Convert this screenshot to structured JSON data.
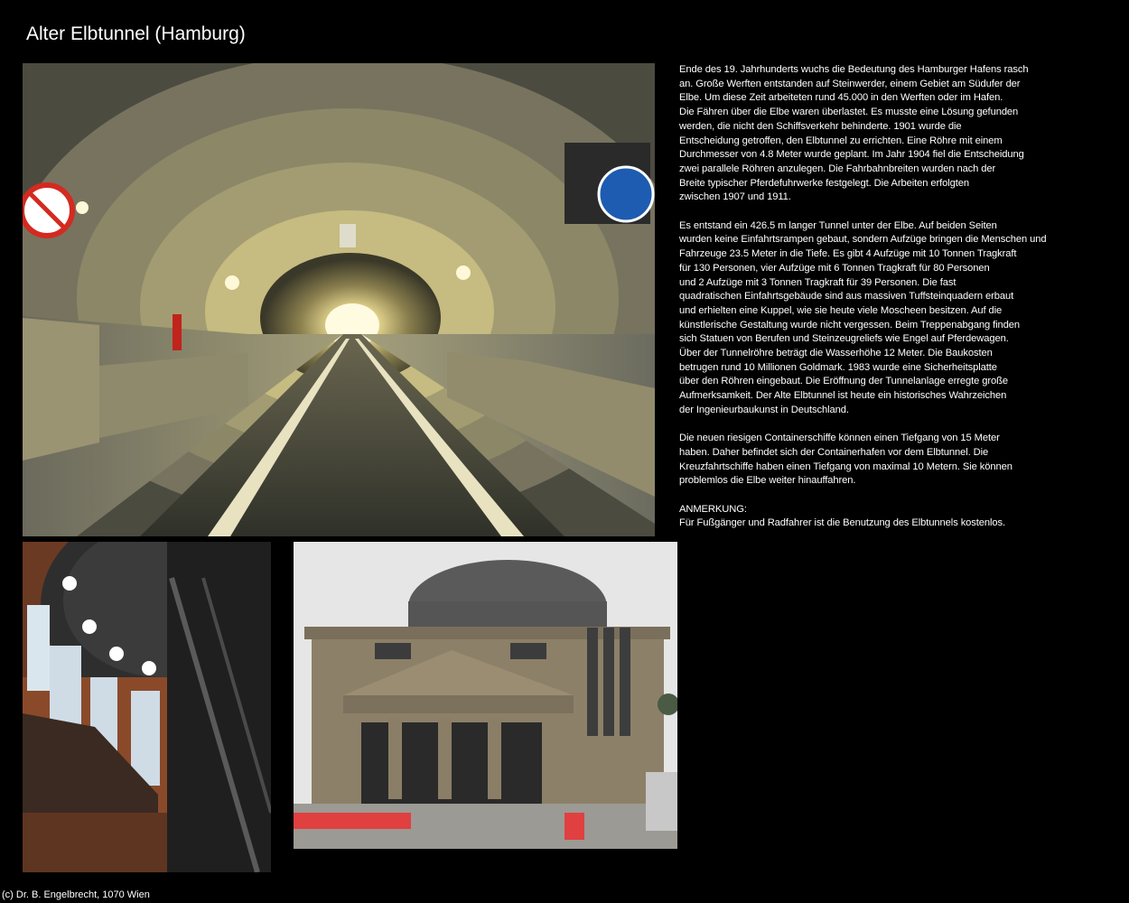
{
  "page": {
    "title": "Alter Elbtunnel (Hamburg)",
    "background_color": "#000000",
    "text_color": "#ffffff"
  },
  "photos": {
    "tunnel": {
      "subject": "tunnel-interior-photo"
    },
    "dome": {
      "subject": "shaft-dome-interior-photo"
    },
    "building": {
      "subject": "entrance-building-photo"
    }
  },
  "description": {
    "paragraphs": [
      "Ende des 19. Jahrhunderts wuchs die Bedeutung des Hamburger Hafens rasch\nan. Große Werften entstanden auf Steinwerder, einem Gebiet am Südufer der\nElbe. Um diese Zeit arbeiteten rund 45.000 in den Werften oder im Hafen.\nDie Fähren über die Elbe waren überlastet. Es musste eine Lösung gefunden\nwerden, die nicht den Schiffsverkehr behinderte. 1901 wurde die\nEntscheidung getroffen, den Elbtunnel zu errichten. Eine Röhre mit einem\nDurchmesser von 4.8 Meter wurde geplant. Im Jahr 1904 fiel die Entscheidung\nzwei parallele Röhren anzulegen. Die Fahrbahnbreiten wurden nach der\nBreite typischer Pferdefuhrwerke festgelegt. Die Arbeiten erfolgten\nzwischen 1907 und 1911.",
      "Es entstand ein 426.5 m langer Tunnel unter der Elbe. Auf beiden Seiten\nwurden keine Einfahrtsrampen gebaut, sondern Aufzüge bringen die Menschen und\nFahrzeuge 23.5 Meter in die Tiefe. Es gibt 4 Aufzüge mit 10 Tonnen Tragkraft\nfür 130 Personen, vier Aufzüge mit 6 Tonnen Tragkraft für 80 Personen\nund 2 Aufzüge mit 3 Tonnen Tragkraft für 39 Personen. Die fast\nquadratischen Einfahrtsgebäude sind aus massiven Tuffsteinquadern erbaut\nund erhielten eine Kuppel, wie sie heute viele Moscheen besitzen. Auf die\nkünstlerische Gestaltung wurde nicht vergessen. Beim Treppenabgang finden\nsich Statuen von Berufen und Steinzeugreliefs wie Engel auf Pferdewagen.\nÜber der Tunnelröhre beträgt die Wasserhöhe 12 Meter. Die Baukosten\nbetrugen rund 10 Millionen Goldmark. 1983 wurde eine Sicherheitsplatte\nüber den Röhren eingebaut. Die Eröffnung der Tunnelanlage erregte große\nAufmerksamkeit. Der Alte Elbtunnel ist heute ein historisches Wahrzeichen\nder Ingenieurbaukunst in Deutschland.",
      "Die neuen riesigen Containerschiffe können einen Tiefgang von 15 Meter\nhaben. Daher befindet sich der Containerhafen vor dem Elbtunnel. Die\nKreuzfahrtschiffe haben einen Tiefgang von maximal 10 Metern. Sie können\nproblemlos die Elbe weiter hinauffahren.",
      "ANMERKUNG:\nFür Fußgänger und Radfahrer ist die Benutzung des Elbtunnels kostenlos."
    ]
  },
  "footer": {
    "copyright": "(c) Dr. B. Engelbrecht, 1070 Wien"
  }
}
